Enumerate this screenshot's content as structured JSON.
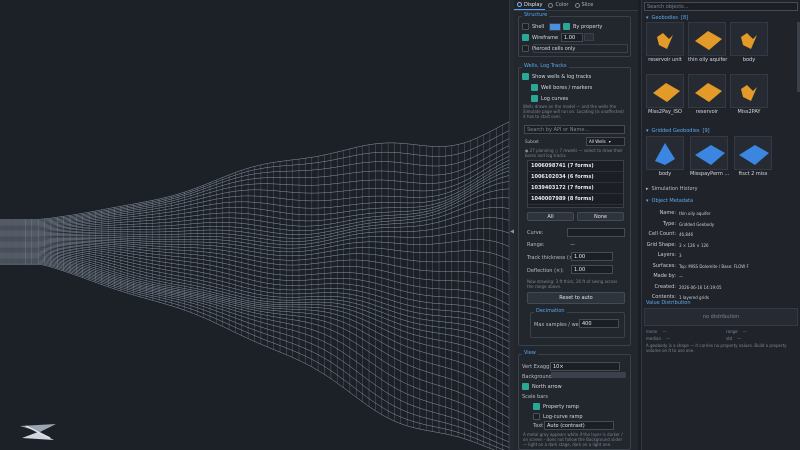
{
  "viewport": {
    "logo_name": "app-logo"
  },
  "splitter_glyph": "◀",
  "tabs": [
    {
      "label": "Display",
      "active": true
    },
    {
      "label": "Color",
      "active": false
    },
    {
      "label": "Slice",
      "active": false
    }
  ],
  "structure": {
    "title": "Structure",
    "shell_label": "Shell",
    "by_property_label": "By property",
    "wireframe_label": "Wireframe",
    "wireframe_value": "1.00",
    "pierced_label": "Pierced cells only"
  },
  "wells": {
    "title": "Wells, Log Tracks",
    "show_label": "Show wells & log tracks",
    "bores_label": "Well bores / markers",
    "logcurves_label": "Log curves",
    "help": "Wells drawn on the model — and the wells the Simulate page will run on. Locating (is unaffected) it has to start over.",
    "search_placeholder": "Search by API or Name...",
    "subset_label": "Subset",
    "subset_value": "All Wells",
    "status": "● 27 planning  ○ 7 rewells  — select to draw their bores and log tracks",
    "items": [
      {
        "api": "1006098741",
        "forms": "(7 forms)"
      },
      {
        "api": "1006102034",
        "forms": "(6 forms)"
      },
      {
        "api": "1039403172",
        "forms": "(7 forms)"
      },
      {
        "api": "1040007989",
        "forms": "(8 forms)"
      }
    ],
    "all_btn": "All",
    "none_btn": "None",
    "curve_label": "Curve:",
    "range_label": "Range:",
    "range_value": "—",
    "track_label": "Track thickness (×):",
    "track_value": "1.00",
    "deflection_label": "Deflection (×):",
    "deflection_value": "1.00",
    "note": "Now drawing: 3 ft thick, 26 ft of swing across the range above.",
    "reset_btn": "Reset to auto",
    "decimation_title": "Decimation",
    "max_samples_label": "Max samples / well:",
    "max_samples_value": "400"
  },
  "view": {
    "title": "View",
    "vert_label": "Vert Exagg:",
    "vert_value": "10×",
    "background_label": "Background",
    "north_label": "North arrow",
    "scale_label": "Scale bars",
    "prop_ramp_label": "Property ramp",
    "log_ramp_label": "Log-curve ramp",
    "text_label": "Text",
    "text_value": "Auto (contrast)",
    "note": "A metal grey appears white if the layer is darker / on screen - does not follow the Background slider — light on a dark stage, dark on a light one."
  },
  "right": {
    "search_placeholder": "Search objects...",
    "geobodies_title": "Geobodies",
    "geobodies_count": "[8]",
    "geobodies": [
      "reservoir unit",
      "thin oily aquifer",
      "body",
      "Miss2Pay_ISO",
      "reservoir",
      "Miss2PAY"
    ],
    "gridded_title": "Gridded Geobodies",
    "gridded_count": "[9]",
    "gridded": [
      "body",
      "MisspayPerm ...",
      "ftsct 2 miss"
    ],
    "sim_history": "Simulation History",
    "metadata_title": "Object Metadata",
    "meta": [
      {
        "k": "Name:",
        "v": "thin oily aquifer"
      },
      {
        "k": "Type:",
        "v": "Gridded Geobody"
      },
      {
        "k": "Cell Count:",
        "v": "46,846"
      },
      {
        "k": "Grid Shape:",
        "v": "3 × 126 × 126"
      },
      {
        "k": "Layers:",
        "v": "3"
      },
      {
        "k": "Surfaces:",
        "v": "Top: MISS Dolomite  /  Base: FLOW F"
      },
      {
        "k": "Made by:",
        "v": "—"
      },
      {
        "k": "Created:",
        "v": "2026-06-16 14:19:05"
      },
      {
        "k": "Contents:",
        "v": "1 layered grids"
      }
    ],
    "value_dist": "Value Distribution",
    "no_dist": "no distribution",
    "stats": [
      {
        "k": "mean",
        "v": "—"
      },
      {
        "k": "range",
        "v": "—"
      },
      {
        "k": "median",
        "v": "—"
      },
      {
        "k": "std",
        "v": "—"
      }
    ],
    "footer": "A geobody is a shape — it carries no property values. Build a property volume on it to use one."
  },
  "colors": {
    "accent": "#5aa8f0",
    "teal": "#2ba795",
    "thumb_orange": "#e39a28",
    "thumb_blue": "#3b86e0",
    "mesh": "#b8c6da"
  }
}
